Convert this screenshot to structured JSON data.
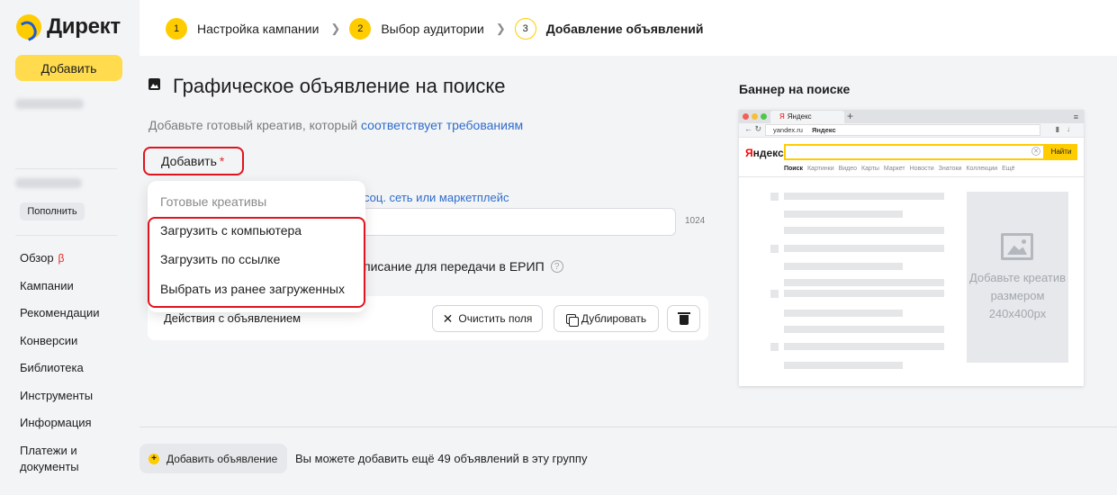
{
  "sidebar": {
    "logo_text": "Директ",
    "add_button": "Добавить",
    "topup_button": "Пополнить",
    "nav": [
      {
        "label": "Обзор",
        "badge": "β"
      },
      {
        "label": "Кампании"
      },
      {
        "label": "Рекомендации"
      },
      {
        "label": "Конверсии"
      },
      {
        "label": "Библиотека"
      },
      {
        "label": "Инструменты"
      },
      {
        "label": "Информация"
      },
      {
        "label": "Платежи и документы"
      }
    ]
  },
  "steps": [
    {
      "num": "1",
      "label": "Настройка кампании"
    },
    {
      "num": "2",
      "label": "Выбор аудитории"
    },
    {
      "num": "3",
      "label": "Добавление объявлений"
    }
  ],
  "main": {
    "title": "Графическое объявление на поиске",
    "subtitle_prefix": "Добавьте готовый креатив, который ",
    "subtitle_link": "соответствует требованиям",
    "add_field_label": "Добавить",
    "required_mark": "*",
    "partial_link": "соц. сеть или маркетплейс",
    "counter": "1024",
    "erip_text": "писание для передачи в ЕРИП",
    "help_icon": "?",
    "dropdown": {
      "header": "Готовые креативы",
      "items": [
        "Загрузить с компьютера",
        "Загрузить по ссылке",
        "Выбрать из ранее загруженных"
      ]
    },
    "actions": {
      "label": "Действия с объявлением",
      "clear": "Очистить поля",
      "duplicate": "Дублировать"
    }
  },
  "preview": {
    "title": "Баннер на поиске",
    "tab_title": "Яндекс",
    "tab_logo": "Я",
    "url": "yandex.ru",
    "url_title": "Яндекс",
    "logo_first": "Я",
    "logo_rest": "ндекс",
    "find_button": "Найти",
    "tabs": [
      "Поиск",
      "Картинки",
      "Видео",
      "Карты",
      "Маркет",
      "Новости",
      "Знатоки",
      "Коллекции",
      "Ещё"
    ],
    "slot_text": "Добавьте креатив размером 240x400px"
  },
  "footer": {
    "add_ad": "Добавить объявление",
    "info": "Вы можете добавить ещё 49 объявлений в эту группу"
  },
  "colors": {
    "accent": "#ffcc00",
    "link": "#2f6ccc",
    "highlight": "#e0141e"
  }
}
